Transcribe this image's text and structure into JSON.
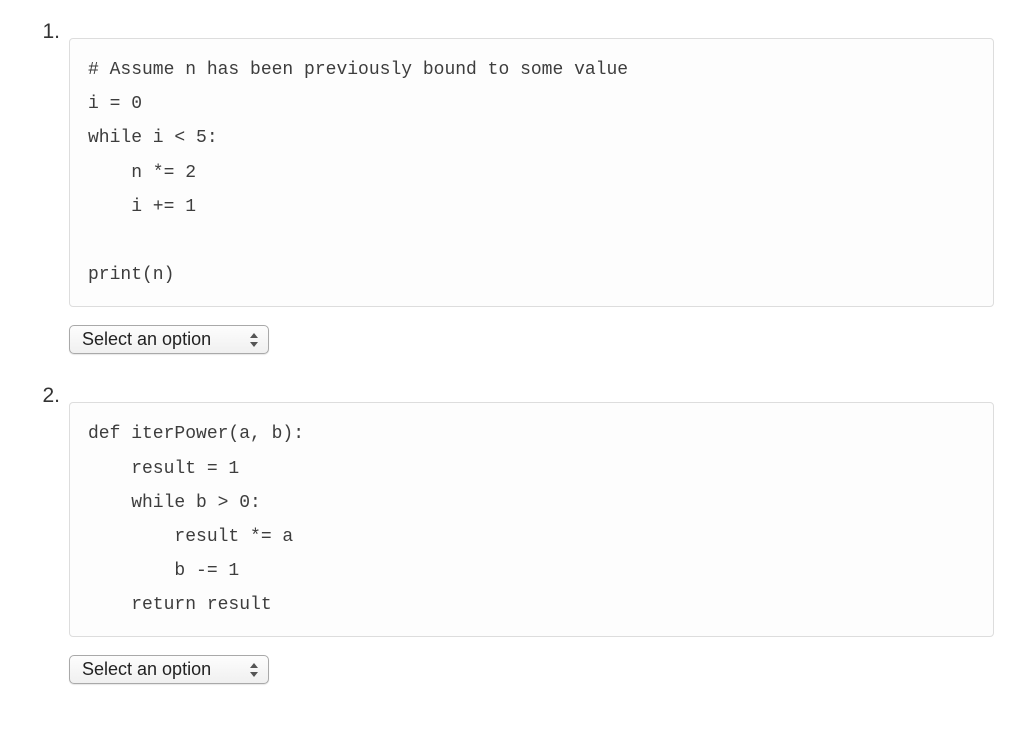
{
  "questions": [
    {
      "number": "1.",
      "code": "# Assume n has been previously bound to some value\ni = 0\nwhile i < 5:\n    n *= 2\n    i += 1\n\nprint(n)",
      "select_placeholder": "Select an option"
    },
    {
      "number": "2.",
      "code": "def iterPower(a, b):\n    result = 1\n    while b > 0:\n        result *= a\n        b -= 1\n    return result",
      "select_placeholder": "Select an option"
    }
  ]
}
